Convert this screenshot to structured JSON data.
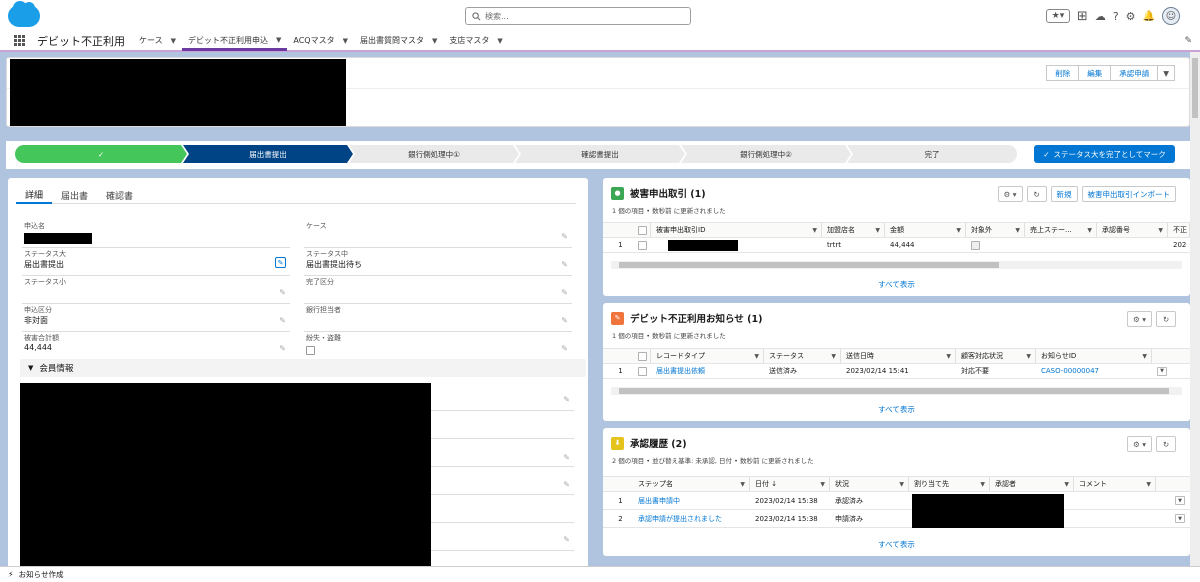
{
  "header": {
    "search_placeholder": "検索..."
  },
  "nav": {
    "app_name": "デビット不正利用",
    "tabs": [
      {
        "label": "ケース"
      },
      {
        "label": "デビット不正利用申込"
      },
      {
        "label": "ACQマスタ"
      },
      {
        "label": "届出書質問マスタ"
      },
      {
        "label": "支店マスタ"
      }
    ]
  },
  "record": {
    "actions": [
      "削除",
      "編集",
      "承認申請"
    ]
  },
  "path": {
    "steps": [
      "",
      "届出書提出",
      "銀行側処理中①",
      "確認書提出",
      "銀行側処理中②",
      "完了"
    ],
    "mark_button": "ステータス大を完了としてマーク"
  },
  "detail": {
    "tabs": [
      "詳細",
      "届出書",
      "確認書"
    ],
    "fields": {
      "apply_no": {
        "label": "申込名"
      },
      "case": {
        "label": "ケース"
      },
      "status_large": {
        "label": "ステータス大",
        "value": "届出書提出"
      },
      "status_mid": {
        "label": "ステータス中",
        "value": "届出書提出待ち"
      },
      "status_small": {
        "label": "ステータス小"
      },
      "complete_div": {
        "label": "完了区分"
      },
      "apply_div": {
        "label": "申込区分",
        "value": "非対面"
      },
      "bank_staff": {
        "label": "銀行担当者"
      },
      "damage_total": {
        "label": "被害合計額",
        "value": "44,444"
      },
      "lost_stolen": {
        "label": "紛失・盗難"
      }
    },
    "section_member": "会員情報"
  },
  "damage": {
    "title": "被害申出取引 (1)",
    "subtitle": "1 個の項目 • 数秒前 に更新されました",
    "buttons": [
      "新規",
      "被害申出取引インポート"
    ],
    "columns": [
      "被害申出取引ID",
      "加盟店名",
      "金額",
      "対象外",
      "売上ステー...",
      "承認番号",
      "不正"
    ],
    "rows": [
      {
        "no": "1",
        "merchant": "trtrt",
        "amount": "44,444",
        "extra": "202"
      }
    ],
    "view_all": "すべて表示"
  },
  "notice": {
    "title": "デビット不正利用お知らせ (1)",
    "subtitle": "1 個の項目 • 数秒前 に更新されました",
    "columns": [
      "レコードタイプ",
      "ステータス",
      "送信日時",
      "顧客対応状況",
      "お知らせID"
    ],
    "rows": [
      {
        "no": "1",
        "type": "届出書提出依頼",
        "status": "送信済み",
        "sent": "2023/02/14 15:41",
        "response": "対応不要",
        "id": "CASO-00000047"
      }
    ],
    "view_all": "すべて表示"
  },
  "approval": {
    "title": "承認履歴 (2)",
    "subtitle": "2 個の項目 • 並び替え基準: 未承認, 日付 • 数秒前 に更新されました",
    "columns": [
      "ステップ名",
      "日付 ↓",
      "状況",
      "割り当て先",
      "承認者",
      "コメント"
    ],
    "rows": [
      {
        "no": "1",
        "step": "届出書申請中",
        "date": "2023/02/14 15:38",
        "status": "承認済み"
      },
      {
        "no": "2",
        "step": "承認申請が提出されました",
        "date": "2023/02/14 15:38",
        "status": "申請済み"
      }
    ],
    "view_all": "すべて表示"
  },
  "footer": {
    "label": "お知らせ作成"
  },
  "colors": {
    "brand": "#0176d3",
    "path_done": "#45c65a",
    "path_current": "#014486"
  }
}
